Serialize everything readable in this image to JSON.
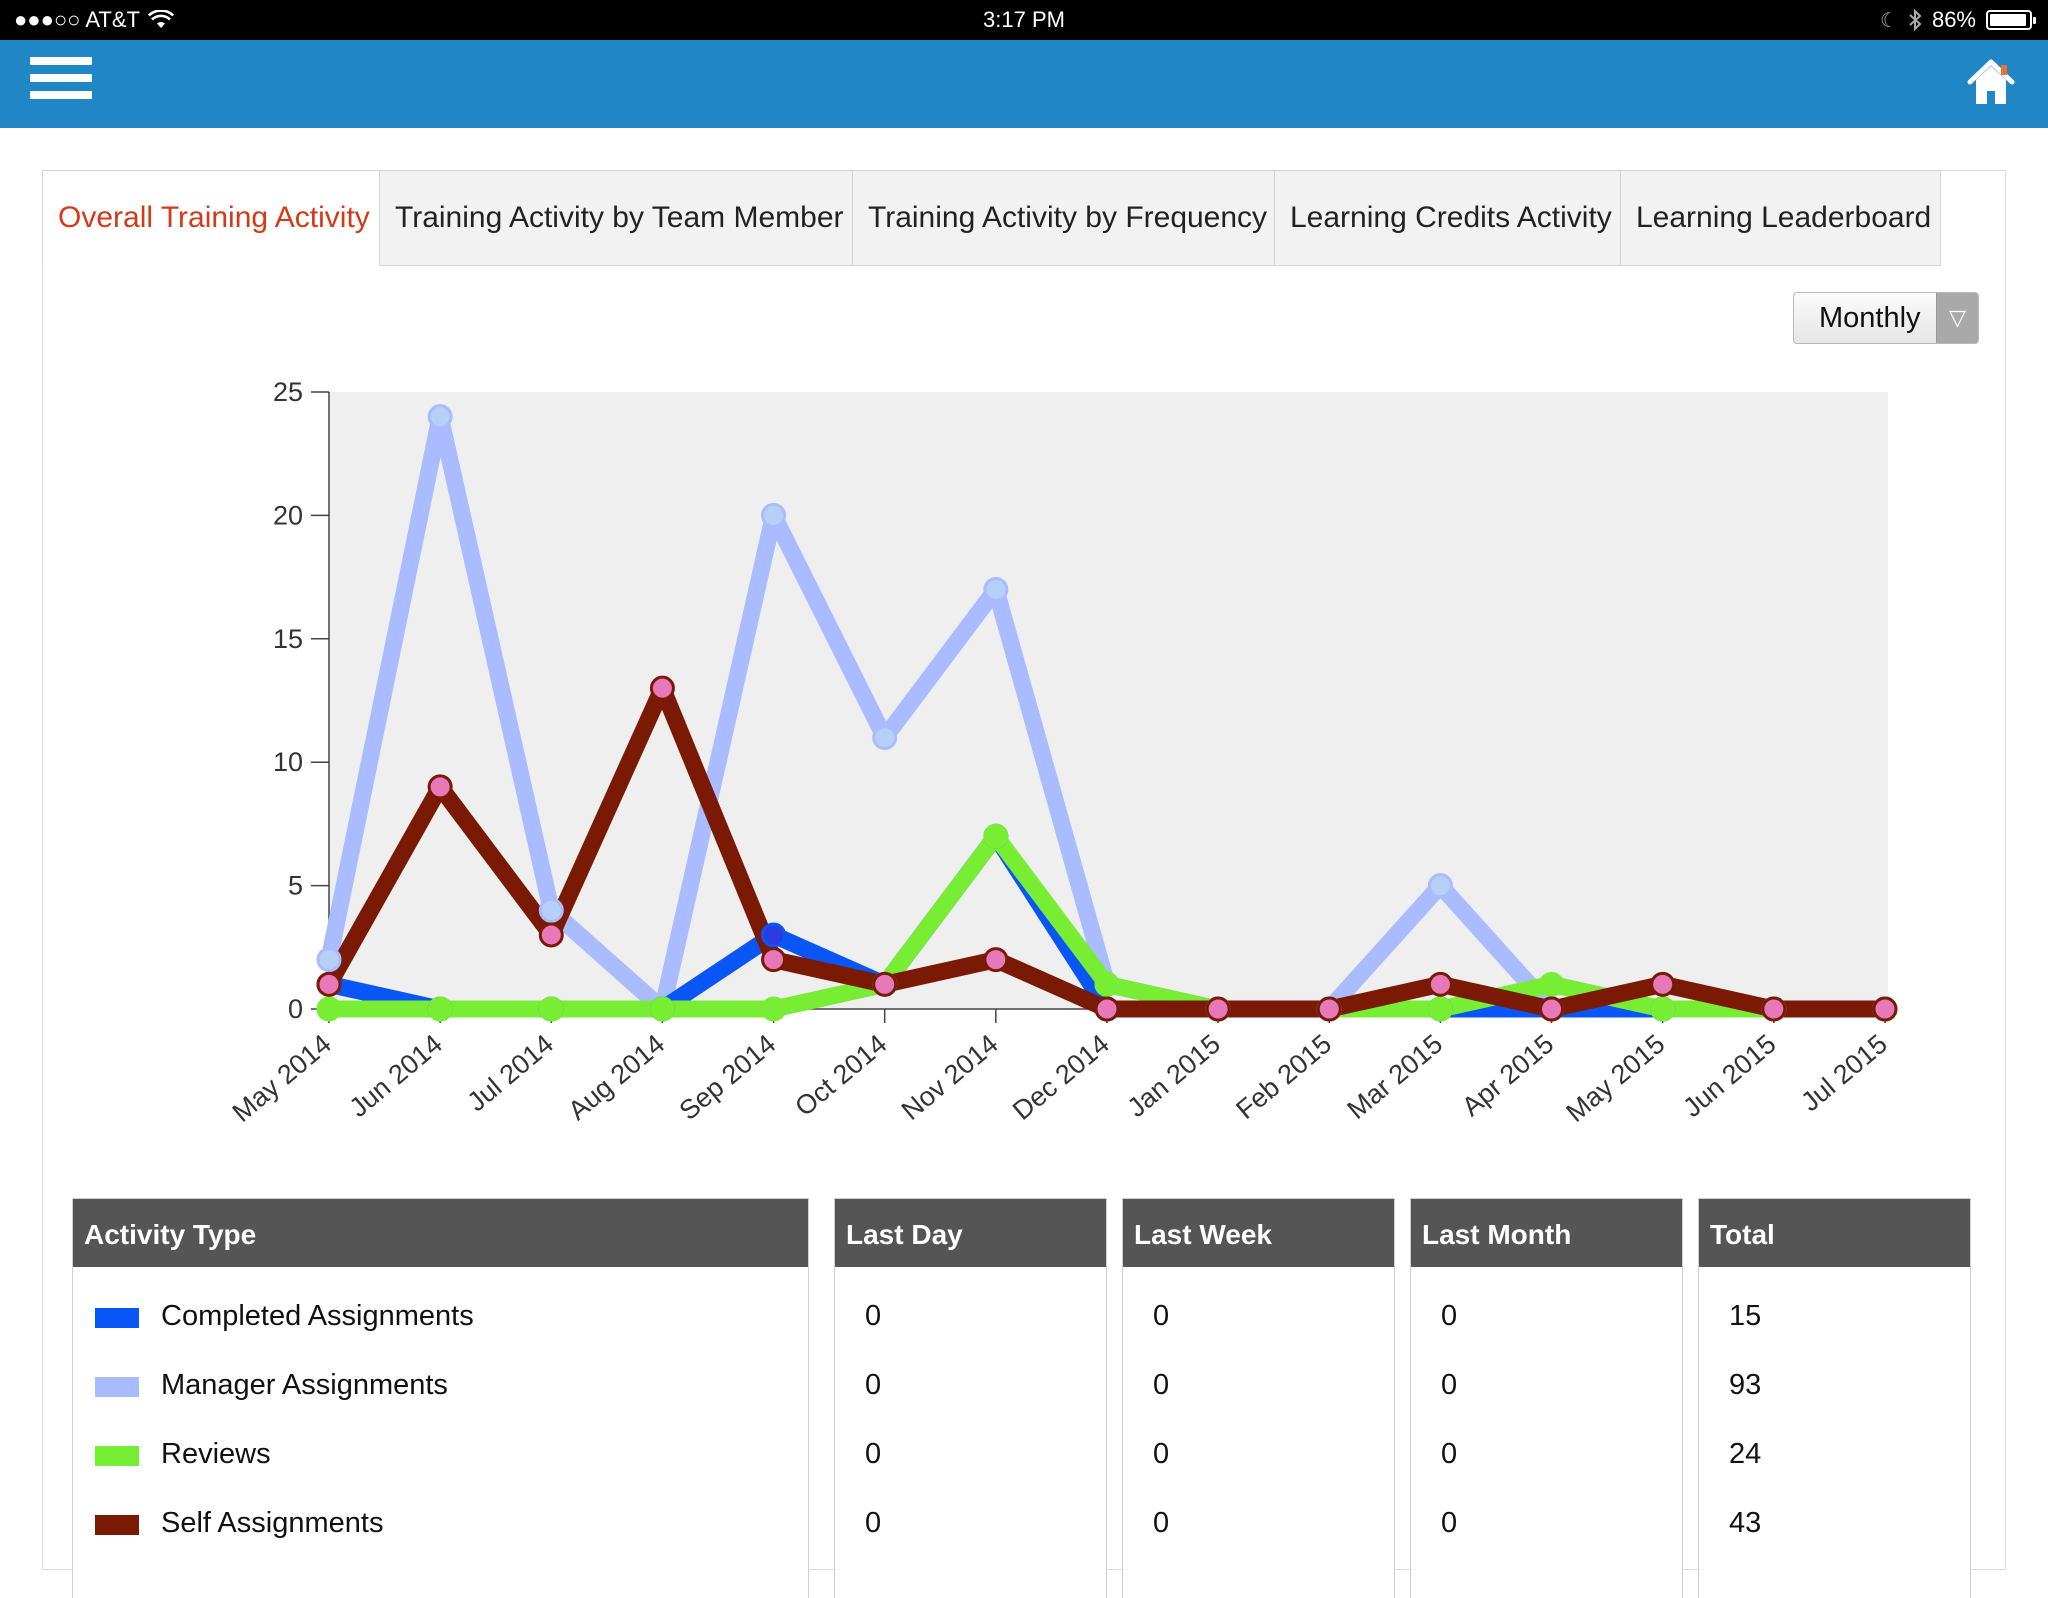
{
  "status_bar": {
    "carrier": "●●●○○ AT&T",
    "time": "3:17 PM",
    "battery": "86%"
  },
  "header": {
    "menu_icon": "hamburger-menu-icon",
    "home_icon": "home-icon"
  },
  "tabs": [
    {
      "label": "Overall Training Activity",
      "active": true
    },
    {
      "label": "Training Activity by Team Member",
      "active": false
    },
    {
      "label": "Training Activity by Frequency",
      "active": false
    },
    {
      "label": "Learning Credits Activity",
      "active": false
    },
    {
      "label": "Learning Leaderboard",
      "active": false
    }
  ],
  "period_select": {
    "value": "Monthly"
  },
  "chart_data": {
    "type": "line",
    "categories": [
      "May 2014",
      "Jun 2014",
      "Jul 2014",
      "Aug 2014",
      "Sep 2014",
      "Oct 2014",
      "Nov 2014",
      "Dec 2014",
      "Jan 2015",
      "Feb 2015",
      "Mar 2015",
      "Apr 2015",
      "May 2015",
      "Jun 2015",
      "Jul 2015"
    ],
    "ylim": [
      0,
      25
    ],
    "yticks": [
      0,
      5,
      10,
      15,
      20,
      25
    ],
    "grid": false,
    "plot_background": "#efefef",
    "series": [
      {
        "name": "Manager Assignments",
        "color": "#aabbff",
        "marker": "#b6d0f8",
        "values": [
          2,
          24,
          4,
          0,
          20,
          11,
          17,
          1,
          0,
          0,
          5,
          0,
          0,
          0,
          0
        ]
      },
      {
        "name": "Completed Assignments",
        "color": "#0a55f5",
        "marker": "#2a3be0",
        "values": [
          1,
          0,
          0,
          0,
          3,
          1,
          7,
          0,
          0,
          0,
          0,
          0,
          0,
          0,
          0
        ]
      },
      {
        "name": "Reviews",
        "color": "#77ee33",
        "marker": "#77ee33",
        "values": [
          0,
          0,
          0,
          0,
          0,
          1,
          7,
          1,
          0,
          0,
          0,
          1,
          0,
          0,
          0
        ]
      },
      {
        "name": "Self Assignments",
        "color": "#7a1a05",
        "marker": "#e879b9",
        "values": [
          1,
          9,
          3,
          13,
          2,
          1,
          2,
          0,
          0,
          0,
          1,
          0,
          1,
          0,
          0
        ]
      }
    ]
  },
  "table": {
    "headers": {
      "activity_type": "Activity Type",
      "last_day": "Last Day",
      "last_week": "Last Week",
      "last_month": "Last Month",
      "total": "Total"
    },
    "rows": [
      {
        "label": "Completed Assignments",
        "color": "#0a55f5",
        "last_day": "0",
        "last_week": "0",
        "last_month": "0",
        "total": "15"
      },
      {
        "label": "Manager Assignments",
        "color": "#aabbff",
        "last_day": "0",
        "last_week": "0",
        "last_month": "0",
        "total": "93"
      },
      {
        "label": "Reviews",
        "color": "#77ee33",
        "last_day": "0",
        "last_week": "0",
        "last_month": "0",
        "total": "24"
      },
      {
        "label": "Self Assignments",
        "color": "#7a1a05",
        "last_day": "0",
        "last_week": "0",
        "last_month": "0",
        "total": "43"
      }
    ]
  }
}
